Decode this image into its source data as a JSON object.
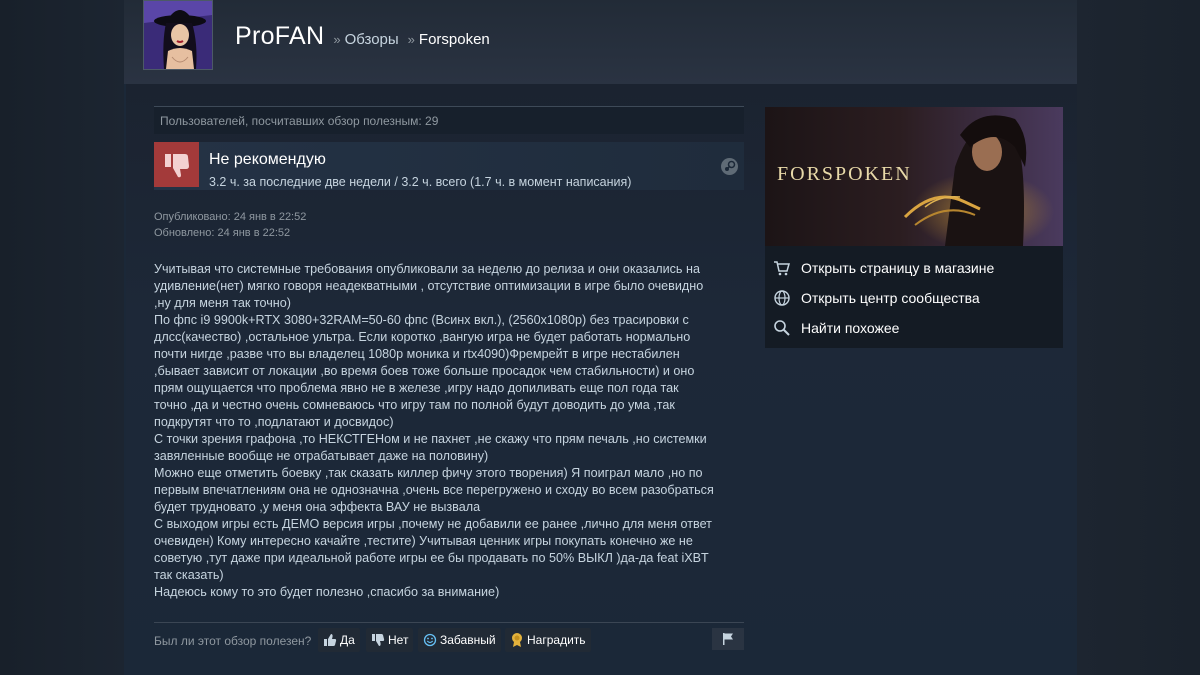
{
  "header": {
    "username": "ProFAN",
    "separator": "»",
    "crumb_reviews": "Обзоры",
    "crumb_game": "Forspoken"
  },
  "review": {
    "helpful_count": "Пользователей, посчитавших обзор полезным: 29",
    "recommendation": "Не рекомендую",
    "hours": "3.2 ч. за последние две недели / 3.2 ч. всего (1.7 ч. в момент написания)",
    "published": "Опубликовано: 24 янв в 22:52",
    "updated": "Обновлено: 24 янв в 22:52",
    "lines": [
      "Учитывая что системные требования опубликовали за неделю до релиза и они оказались на",
      "удивление(нет) мягко говоря неадекватными , отсутствие оптимизации в игре было очевидно",
      ",ну для меня так точно)",
      "По фпс i9 9900k+RTX 3080+32RAM=50-60 фпс (Всинх вкл.), (2560x1080p) без трасировки с",
      "длсс(качество) ,остальное ультра. Если коротко ,вангую игра не будет работать нормально",
      "почти нигде ,разве что вы владелец 1080p моника и rtx4090)Фремрейт в игре нестабилен",
      ",бывает зависит от локации ,во время боев тоже больше просадок чем стабильности) и оно",
      "прям ощущается что проблема явно не в железе ,игру надо допиливать еще пол года так",
      "точно ,да и честно очень сомневаюсь что игру там по полной будут доводить до ума ,так",
      "подкрутят что то ,подлатают и досвидос)",
      "С точки зрения графона ,то НЕКСТГЕНом и не пахнет ,не скажу что прям печаль ,но системки",
      "завяленные вообще не отрабатывает даже на половину)",
      "Можно еще отметить боевку ,так сказать киллер фичу этого творения) Я поиграл мало ,но по",
      "первым впечатлениям она не однозначна ,очень все перегружено и сходу во всем разобраться",
      "будет трудновато ,у меня она эффекта ВАУ не вызвала",
      "С выходом игры есть ДЕМО версия игры ,почему не добавили ее ранее ,лично для меня ответ",
      "очевиден) Кому интересно качайте ,тестите) Учитывая ценник игры покупать конечно же не",
      "советую ,тут даже при идеальной работе игры ее бы продавать по 50% ВЫКЛ )да-да feat iXBT",
      "так сказать)",
      "Надеюсь кому то это будет полезно ,спасибо за внимание)"
    ]
  },
  "footer": {
    "question": "Был ли этот обзор полезен?",
    "yes": "Да",
    "no": "Нет",
    "funny": "Забавный",
    "award": "Наградить"
  },
  "sidebar": {
    "game_logo": "FORSPOKEN",
    "links": [
      {
        "label": "Открыть страницу в магазине",
        "icon": "cart-icon"
      },
      {
        "label": "Открыть центр сообщества",
        "icon": "globe-icon"
      },
      {
        "label": "Найти похожее",
        "icon": "search-icon"
      }
    ]
  },
  "colors": {
    "background": "#1b2838",
    "thumb_down": "#a33a3a",
    "award_gold": "#e3b23c",
    "funny_blue": "#66c0f4"
  }
}
